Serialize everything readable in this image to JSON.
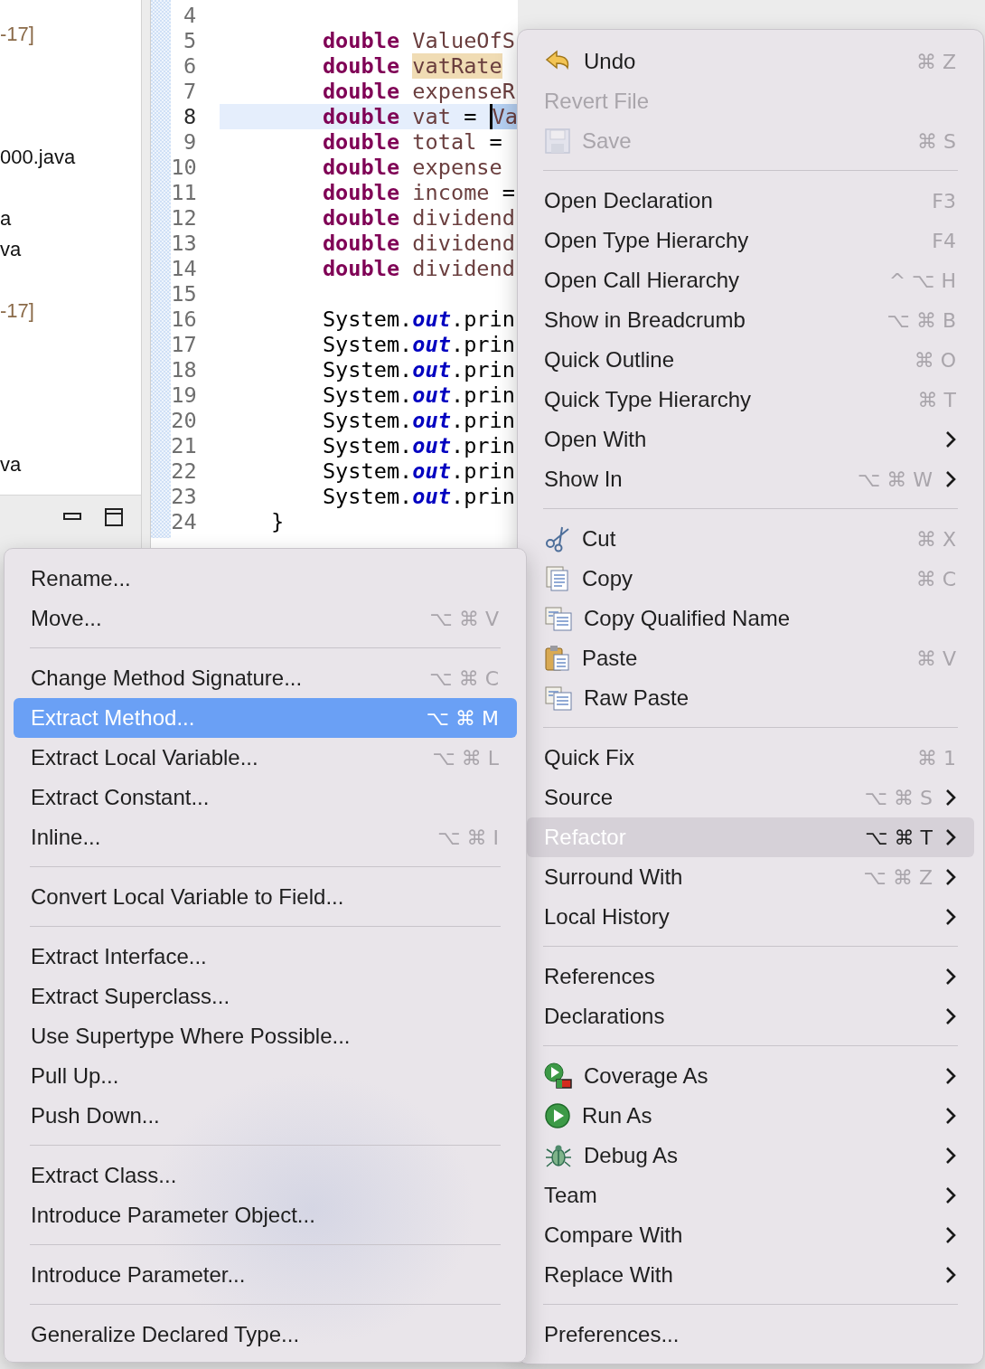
{
  "explorer": {
    "rows": [
      {
        "kind": "library",
        "text": "-17]"
      },
      {
        "kind": "blank"
      },
      {
        "kind": "blank"
      },
      {
        "kind": "blank"
      },
      {
        "kind": "file",
        "text": "000.java"
      },
      {
        "kind": "blank"
      },
      {
        "kind": "file",
        "text": "a"
      },
      {
        "kind": "file",
        "text": "va"
      },
      {
        "kind": "blank"
      },
      {
        "kind": "library",
        "text": "-17]"
      },
      {
        "kind": "blank"
      },
      {
        "kind": "blank"
      },
      {
        "kind": "blank"
      },
      {
        "kind": "blank"
      },
      {
        "kind": "file",
        "text": "va"
      }
    ]
  },
  "editor": {
    "lines": [
      {
        "number": "4",
        "current": false
      },
      {
        "number": "5",
        "current": false,
        "code": [
          {
            "kind": "keyword",
            "text": "        double"
          },
          {
            "kind": "local",
            "text": " ValueOfS"
          }
        ]
      },
      {
        "number": "6",
        "current": false,
        "code": [
          {
            "kind": "keyword",
            "text": "        double "
          },
          {
            "kind": "occurrence",
            "text": "vatRate"
          }
        ]
      },
      {
        "number": "7",
        "current": false,
        "code": [
          {
            "kind": "keyword",
            "text": "        double"
          },
          {
            "kind": "local",
            "text": " expenseR"
          }
        ]
      },
      {
        "number": "8",
        "current": true,
        "code": [
          {
            "kind": "keyword",
            "text": "        double"
          },
          {
            "kind": "local",
            "text": " vat"
          },
          {
            "kind": "plain",
            "text": " = "
          },
          {
            "kind": "selection",
            "text": "Va"
          }
        ]
      },
      {
        "number": "9",
        "current": false,
        "code": [
          {
            "kind": "keyword",
            "text": "        double"
          },
          {
            "kind": "local",
            "text": " total"
          },
          {
            "kind": "plain",
            "text": " ="
          }
        ]
      },
      {
        "number": "10",
        "current": false,
        "code": [
          {
            "kind": "keyword",
            "text": "        double"
          },
          {
            "kind": "local",
            "text": " expense"
          }
        ]
      },
      {
        "number": "11",
        "current": false,
        "code": [
          {
            "kind": "keyword",
            "text": "        double"
          },
          {
            "kind": "local",
            "text": " income"
          },
          {
            "kind": "plain",
            "text": " ="
          }
        ]
      },
      {
        "number": "12",
        "current": false,
        "code": [
          {
            "kind": "keyword",
            "text": "        double"
          },
          {
            "kind": "local",
            "text": " dividend"
          }
        ]
      },
      {
        "number": "13",
        "current": false,
        "code": [
          {
            "kind": "keyword",
            "text": "        double"
          },
          {
            "kind": "local",
            "text": " dividend"
          }
        ]
      },
      {
        "number": "14",
        "current": false,
        "code": [
          {
            "kind": "keyword",
            "text": "        double"
          },
          {
            "kind": "local",
            "text": " dividend"
          }
        ]
      },
      {
        "number": "15",
        "current": false
      },
      {
        "number": "16",
        "current": false,
        "code": [
          {
            "kind": "plain",
            "text": "        System."
          },
          {
            "kind": "field",
            "text": "out"
          },
          {
            "kind": "plain",
            "text": ".prin"
          }
        ]
      },
      {
        "number": "17",
        "current": false,
        "code": [
          {
            "kind": "plain",
            "text": "        System."
          },
          {
            "kind": "field",
            "text": "out"
          },
          {
            "kind": "plain",
            "text": ".prin"
          }
        ]
      },
      {
        "number": "18",
        "current": false,
        "code": [
          {
            "kind": "plain",
            "text": "        System."
          },
          {
            "kind": "field",
            "text": "out"
          },
          {
            "kind": "plain",
            "text": ".prin"
          }
        ]
      },
      {
        "number": "19",
        "current": false,
        "code": [
          {
            "kind": "plain",
            "text": "        System."
          },
          {
            "kind": "field",
            "text": "out"
          },
          {
            "kind": "plain",
            "text": ".prin"
          }
        ]
      },
      {
        "number": "20",
        "current": false,
        "code": [
          {
            "kind": "plain",
            "text": "        System."
          },
          {
            "kind": "field",
            "text": "out"
          },
          {
            "kind": "plain",
            "text": ".prin"
          }
        ]
      },
      {
        "number": "21",
        "current": false,
        "code": [
          {
            "kind": "plain",
            "text": "        System."
          },
          {
            "kind": "field",
            "text": "out"
          },
          {
            "kind": "plain",
            "text": ".prin"
          }
        ]
      },
      {
        "number": "22",
        "current": false,
        "code": [
          {
            "kind": "plain",
            "text": "        System."
          },
          {
            "kind": "field",
            "text": "out"
          },
          {
            "kind": "plain",
            "text": ".prin"
          }
        ]
      },
      {
        "number": "23",
        "current": false,
        "code": [
          {
            "kind": "plain",
            "text": "        System."
          },
          {
            "kind": "field",
            "text": "out"
          },
          {
            "kind": "plain",
            "text": ".prin"
          }
        ]
      },
      {
        "number": "24",
        "current": false,
        "code": [
          {
            "kind": "plain",
            "text": "    }"
          }
        ]
      }
    ]
  },
  "context_menu": {
    "items": [
      {
        "kind": "undo",
        "label": "Undo",
        "shortcut": "⌘ Z",
        "submenu": false,
        "disabled": false,
        "selected": false
      },
      {
        "kind": "item",
        "label": "Revert File",
        "submenu": false,
        "disabled": true,
        "selected": false
      },
      {
        "kind": "save",
        "label": "Save",
        "shortcut": "⌘ S",
        "submenu": false,
        "disabled": true,
        "selected": false
      },
      {
        "kind": "separator"
      },
      {
        "kind": "item",
        "label": "Open Declaration",
        "shortcut": "F3",
        "submenu": false,
        "disabled": false,
        "selected": false
      },
      {
        "kind": "item",
        "label": "Open Type Hierarchy",
        "shortcut": "F4",
        "submenu": false,
        "disabled": false,
        "selected": false
      },
      {
        "kind": "item",
        "label": "Open Call Hierarchy",
        "shortcut": "^ ⌥ H",
        "submenu": false,
        "disabled": false,
        "selected": false
      },
      {
        "kind": "item",
        "label": "Show in Breadcrumb",
        "shortcut": "⌥ ⌘ B",
        "submenu": false,
        "disabled": false,
        "selected": false
      },
      {
        "kind": "item",
        "label": "Quick Outline",
        "shortcut": "⌘ O",
        "submenu": false,
        "disabled": false,
        "selected": false
      },
      {
        "kind": "item",
        "label": "Quick Type Hierarchy",
        "shortcut": "⌘ T",
        "submenu": false,
        "disabled": false,
        "selected": false
      },
      {
        "kind": "item",
        "label": "Open With",
        "submenu": true,
        "disabled": false,
        "selected": false
      },
      {
        "kind": "item",
        "label": "Show In",
        "shortcut": "⌥ ⌘ W",
        "submenu": true,
        "disabled": false,
        "selected": false
      },
      {
        "kind": "separator"
      },
      {
        "kind": "cut",
        "label": "Cut",
        "shortcut": "⌘ X",
        "submenu": false,
        "disabled": false,
        "selected": false
      },
      {
        "kind": "copy",
        "label": "Copy",
        "shortcut": "⌘ C",
        "submenu": false,
        "disabled": false,
        "selected": false
      },
      {
        "kind": "pages",
        "label": "Copy Qualified Name",
        "submenu": false,
        "disabled": false,
        "selected": false
      },
      {
        "kind": "paste",
        "label": "Paste",
        "shortcut": "⌘ V",
        "submenu": false,
        "disabled": false,
        "selected": false
      },
      {
        "kind": "pages",
        "label": "Raw Paste",
        "submenu": false,
        "disabled": false,
        "selected": false
      },
      {
        "kind": "separator"
      },
      {
        "kind": "item",
        "label": "Quick Fix",
        "shortcut": "⌘ 1",
        "submenu": false,
        "disabled": false,
        "selected": false
      },
      {
        "kind": "item",
        "label": "Source",
        "shortcut": "⌥ ⌘ S",
        "submenu": true,
        "disabled": false,
        "selected": false
      },
      {
        "kind": "item",
        "label": "Refactor",
        "shortcut": "⌥ ⌘ T",
        "submenu": true,
        "disabled": false,
        "selected": true
      },
      {
        "kind": "item",
        "label": "Surround With",
        "shortcut": "⌥ ⌘ Z",
        "submenu": true,
        "disabled": false,
        "selected": false
      },
      {
        "kind": "item",
        "label": "Local History",
        "submenu": true,
        "disabled": false,
        "selected": false
      },
      {
        "kind": "separator"
      },
      {
        "kind": "item",
        "label": "References",
        "submenu": true,
        "disabled": false,
        "selected": false
      },
      {
        "kind": "item",
        "label": "Declarations",
        "submenu": true,
        "disabled": false,
        "selected": false
      },
      {
        "kind": "separator"
      },
      {
        "kind": "coverage",
        "label": "Coverage As",
        "submenu": true,
        "disabled": false,
        "selected": false
      },
      {
        "kind": "run",
        "label": "Run As",
        "submenu": true,
        "disabled": false,
        "selected": false
      },
      {
        "kind": "debug",
        "label": "Debug As",
        "submenu": true,
        "disabled": false,
        "selected": false
      },
      {
        "kind": "item",
        "label": "Team",
        "submenu": true,
        "disabled": false,
        "selected": false
      },
      {
        "kind": "item",
        "label": "Compare With",
        "submenu": true,
        "disabled": false,
        "selected": false
      },
      {
        "kind": "item",
        "label": "Replace With",
        "submenu": true,
        "disabled": false,
        "selected": false
      },
      {
        "kind": "separator"
      },
      {
        "kind": "item",
        "label": "Preferences...",
        "submenu": false,
        "disabled": false,
        "selected": false
      }
    ]
  },
  "refactor_submenu": {
    "items": [
      {
        "kind": "item",
        "label": "Rename...",
        "submenu": false,
        "disabled": false,
        "selected": false
      },
      {
        "kind": "item",
        "label": "Move...",
        "shortcut": "⌥ ⌘ V",
        "submenu": false,
        "disabled": false,
        "selected": false
      },
      {
        "kind": "separator"
      },
      {
        "kind": "item",
        "label": "Change Method Signature...",
        "shortcut": "⌥ ⌘ C",
        "submenu": false,
        "disabled": false,
        "selected": false
      },
      {
        "kind": "item",
        "label": "Extract Method...",
        "shortcut": "⌥ ⌘ M",
        "submenu": false,
        "disabled": false,
        "selected": true
      },
      {
        "kind": "item",
        "label": "Extract Local Variable...",
        "shortcut": "⌥ ⌘ L",
        "submenu": false,
        "disabled": false,
        "selected": false
      },
      {
        "kind": "item",
        "label": "Extract Constant...",
        "submenu": false,
        "disabled": false,
        "selected": false
      },
      {
        "kind": "item",
        "label": "Inline...",
        "shortcut": "⌥ ⌘ I",
        "submenu": false,
        "disabled": false,
        "selected": false
      },
      {
        "kind": "separator"
      },
      {
        "kind": "item",
        "label": "Convert Local Variable to Field...",
        "submenu": false,
        "disabled": false,
        "selected": false
      },
      {
        "kind": "separator"
      },
      {
        "kind": "item",
        "label": "Extract Interface...",
        "submenu": false,
        "disabled": false,
        "selected": false
      },
      {
        "kind": "item",
        "label": "Extract Superclass...",
        "submenu": false,
        "disabled": false,
        "selected": false
      },
      {
        "kind": "item",
        "label": "Use Supertype Where Possible...",
        "submenu": false,
        "disabled": false,
        "selected": false
      },
      {
        "kind": "item",
        "label": "Pull Up...",
        "submenu": false,
        "disabled": false,
        "selected": false
      },
      {
        "kind": "item",
        "label": "Push Down...",
        "submenu": false,
        "disabled": false,
        "selected": false
      },
      {
        "kind": "separator"
      },
      {
        "kind": "item",
        "label": "Extract Class...",
        "submenu": false,
        "disabled": false,
        "selected": false
      },
      {
        "kind": "item",
        "label": "Introduce Parameter Object...",
        "submenu": false,
        "disabled": false,
        "selected": false
      },
      {
        "kind": "separator"
      },
      {
        "kind": "item",
        "label": "Introduce Parameter...",
        "submenu": false,
        "disabled": false,
        "selected": false
      },
      {
        "kind": "separator"
      },
      {
        "kind": "item",
        "label": "Generalize Declared Type...",
        "submenu": false,
        "disabled": false,
        "selected": false
      }
    ]
  }
}
